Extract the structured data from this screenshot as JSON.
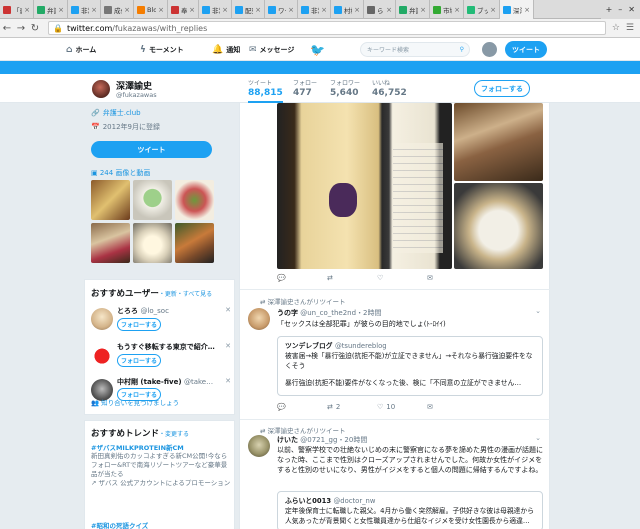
{
  "browser": {
    "tabs": [
      {
        "label": "「患者",
        "color": "#c33"
      },
      {
        "label": "弁護士",
        "color": "#2a6"
      },
      {
        "label": "非常",
        "color": "#1da1f2"
      },
      {
        "label": "成仏し",
        "color": "#777"
      },
      {
        "label": "Blogg",
        "color": "#f57d00"
      },
      {
        "label": "奉納",
        "color": "#c33"
      },
      {
        "label": "非常",
        "color": "#1da1f2"
      },
      {
        "label": "配列",
        "color": "#1da1f2"
      },
      {
        "label": "ワーキ",
        "color": "#1da1f2"
      },
      {
        "label": "非常",
        "color": "#1da1f2"
      },
      {
        "label": "村松",
        "color": "#1da1f2"
      },
      {
        "label": "らめ",
        "color": "#666"
      },
      {
        "label": "弁護士",
        "color": "#2a6"
      },
      {
        "label": "市場",
        "color": "#3a3"
      },
      {
        "label": "ブック",
        "color": "#2b7"
      },
      {
        "label": "深澤",
        "color": "#1da1f2"
      }
    ],
    "url_host": "twitter.com",
    "url_path": "/fukazawas/with_replies"
  },
  "topnav": {
    "home": "ホーム",
    "moments": "モーメント",
    "notifications": "通知",
    "messages": "メッセージ",
    "search_placeholder": "キーワード検索",
    "tweet_button": "ツイート"
  },
  "profile": {
    "name": "深澤諭史",
    "handle": "@fukazawas",
    "stats": [
      {
        "label": "ツイート",
        "value": "88,815",
        "active": true
      },
      {
        "label": "フォロー",
        "value": "477"
      },
      {
        "label": "フォロワー",
        "value": "5,640"
      },
      {
        "label": "いいね",
        "value": "46,752"
      }
    ],
    "follow_button": "フォローする",
    "website": "弁護士.club",
    "joined": "2012年9月に登録",
    "tweet_button": "ツイート",
    "media_link": "244 画像と動画"
  },
  "who_to_follow": {
    "title": "おすすめユーザー",
    "sub": "・更新・すべて見る",
    "items": [
      {
        "name": "とろろ",
        "handle": "@lo_soc",
        "button": "フォローする"
      },
      {
        "name": "もうすぐ移転する東京で紹介…",
        "handle": "",
        "button": "フォローする"
      },
      {
        "name": "中村剛 (take-five)",
        "handle": "@take…",
        "button": "フォローする"
      }
    ],
    "find_friends": "知り合いを見つけましょう"
  },
  "trends": {
    "title": "おすすめトレンド",
    "change": "・変更する",
    "items": [
      {
        "tag": "#ザバスMILKPROTEIN新CM",
        "desc": "新田真剣佑のカッコよすぎる新CM公開!今ならフォロー&RTで南海リゾートツアーなど豪華景品が当たる",
        "promo": "ザバス 公式アカウントによるプロモーション"
      },
      {
        "tag": "#昭和の死語クイズ",
        "desc": "",
        "promo": ""
      }
    ]
  },
  "timeline": {
    "tweet1_actions": {
      "reply": "",
      "retweet": "",
      "like": "",
      "dm": ""
    },
    "tweet2": {
      "retweeted_by": "深澤諭史さんがリツイート",
      "name": "うの字",
      "handle": "@un_co_the2nd",
      "time": "・2時間",
      "body": "「セックスは全部犯罪」が彼らの目的地でしょ(ﾄ-ﾛｲｲ)",
      "quote_name": "ツンデレブログ",
      "quote_handle": "@tsundereblog",
      "quote_line1": "被害届→検「暴行強迫(抗拒不能)が立証できません」→それなら暴行強迫要件をなくそう",
      "quote_line2": "暴行強迫(抗拒不能)要件がなくなった後、検に「不同意の立証ができません…",
      "retweets": "2",
      "likes": "10"
    },
    "tweet3": {
      "retweeted_by": "深澤諭史さんがリツイート",
      "name": "けいた",
      "handle": "@0721_gg",
      "time": "・20時間",
      "body": "以前、警察学校での壮絶ないじめの末に警察官になる夢を諦めた男性の漫画が話題になった時、ここまで性別はクローズアップされませんでした。何故か女性がイジメをすると性別のせいになり、男性がイジメをすると個人の問題に帰結するんですよね。",
      "quote_name": "ふらいと0013",
      "quote_handle": "@doctor_nw",
      "quote_line1": "定年後保育士に転職した親父。4月から働く突然解雇。子供好きな彼は母親達から人気あったが背景聞くと女性職員達から仕組なイジメを受け女性園長から適違…"
    }
  }
}
